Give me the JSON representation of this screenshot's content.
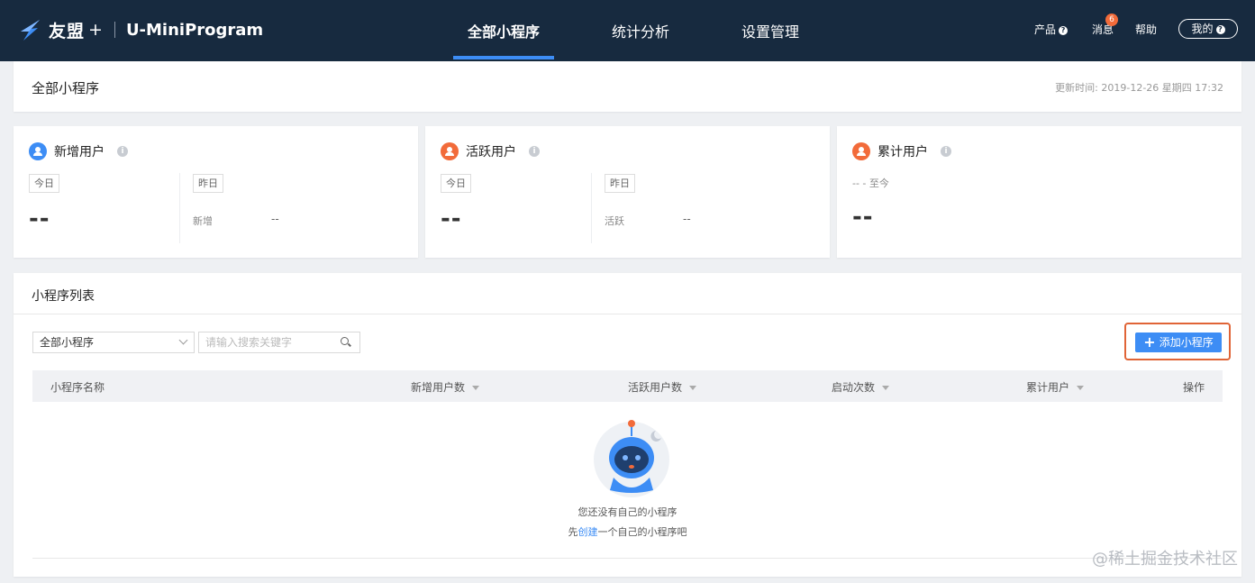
{
  "brand": {
    "name": "友盟",
    "plus": "+",
    "product": "U-MiniProgram"
  },
  "nav": {
    "items": [
      "全部小程序",
      "统计分析",
      "设置管理"
    ],
    "active_index": 0
  },
  "right_nav": {
    "product": "产品",
    "messages": "消息",
    "message_badge": "6",
    "help": "帮助",
    "mine": "我的",
    "product_icon": "?",
    "mine_icon": "?"
  },
  "header": {
    "title": "全部小程序",
    "update_time": "更新时间: 2019-12-26 星期四 17:32"
  },
  "stats": {
    "new_users": {
      "title": "新增用户",
      "today_tag": "今日",
      "yesterday_tag": "昨日",
      "today_value": "--",
      "sub_label": "新增",
      "sub_value": "--",
      "icon_color": "#3d8df5"
    },
    "active_users": {
      "title": "活跃用户",
      "today_tag": "今日",
      "yesterday_tag": "昨日",
      "today_value": "--",
      "sub_label": "活跃",
      "sub_value": "--",
      "icon_color": "#f26b3a"
    },
    "total_users": {
      "title": "累计用户",
      "range": "-- - 至今",
      "value": "--",
      "icon_color": "#f26b3a"
    }
  },
  "list": {
    "title": "小程序列表",
    "filter_selected": "全部小程序",
    "search_placeholder": "请输入搜索关键字",
    "add_button": "添加小程序",
    "columns": [
      "小程序名称",
      "新增用户数",
      "活跃用户数",
      "启动次数",
      "累计用户",
      "操作"
    ],
    "empty_line1": "您还没有自己的小程序",
    "empty_prefix": "先",
    "empty_link": "创建",
    "empty_suffix": "一个自己的小程序吧"
  },
  "watermark": "@稀土掘金技术社区"
}
